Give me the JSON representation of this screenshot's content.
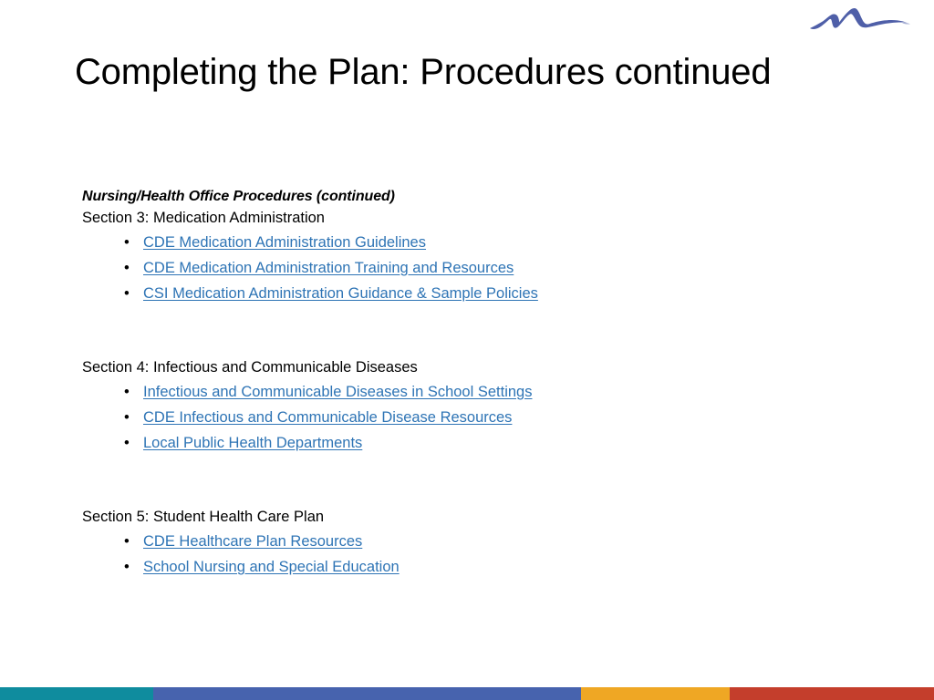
{
  "slide": {
    "title": "Completing the Plan: Procedures continued",
    "logo_name": "organization-logo",
    "logo_color": "#4F5FA8"
  },
  "body": {
    "lead_heading": "Nursing/Health Office Procedures (continued)",
    "sections": [
      {
        "heading": "Section 3: Medication Administration",
        "bullet_char": "•",
        "links": [
          "CDE Medication Administration Guidelines",
          "CDE Medication Administration Training and Resources",
          "CSI Medication Administration Guidance & Sample Policies"
        ]
      },
      {
        "heading": "Section 4: Infectious and Communicable Diseases",
        "bullet_char": "•",
        "links": [
          "Infectious and Communicable Diseases in School Settings",
          "CDE Infectious and Communicable Disease Resources",
          "Local Public Health Departments"
        ]
      },
      {
        "heading": "Section 5: Student Health Care Plan",
        "bullet_char": "•",
        "links": [
          "CDE Healthcare Plan Resources",
          "School Nursing and Special Education"
        ]
      }
    ]
  },
  "colors": {
    "link": "#2E74B5",
    "text": "#000000",
    "background": "#FFFFFF",
    "bar_teal": "#0F8C9E",
    "bar_blue": "#4763AE",
    "bar_orange": "#EFA724",
    "bar_red": "#C43E2C"
  },
  "colorbar": {
    "segments": [
      {
        "name": "teal",
        "color": "#0F8C9E",
        "width_pct": 16.4
      },
      {
        "name": "blue",
        "color": "#4763AE",
        "width_pct": 45.8
      },
      {
        "name": "orange",
        "color": "#EFA724",
        "width_pct": 15.9
      },
      {
        "name": "red",
        "color": "#C43E2C",
        "width_pct": 21.9
      }
    ]
  }
}
